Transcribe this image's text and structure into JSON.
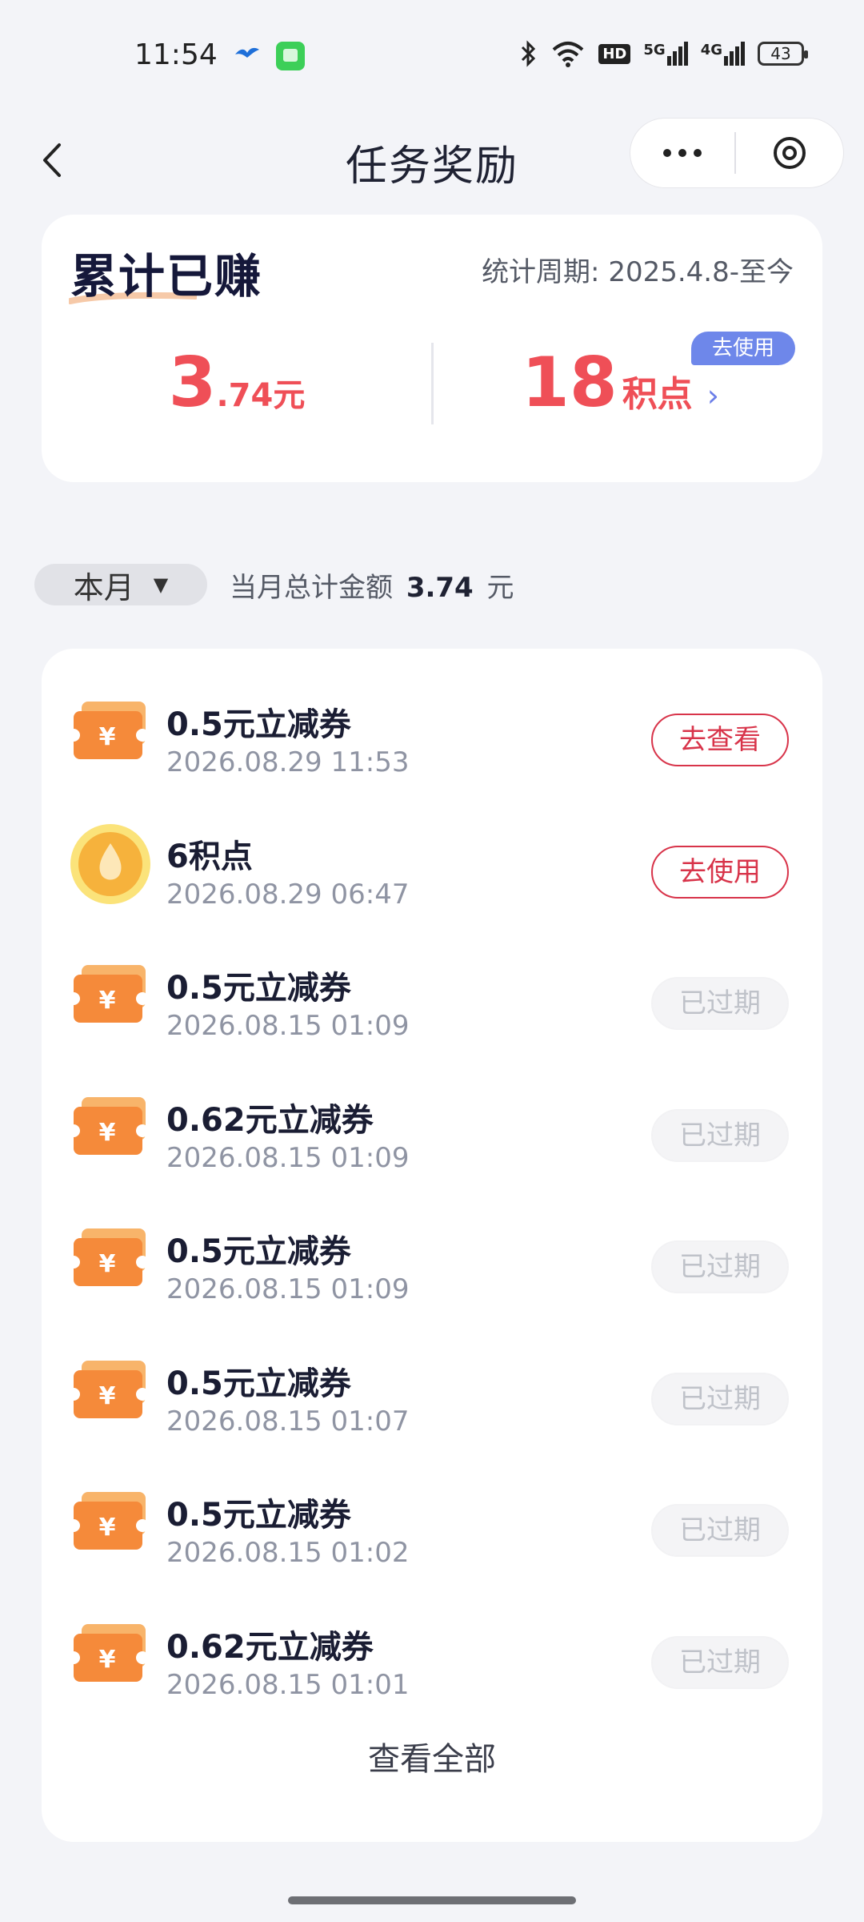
{
  "status_bar": {
    "time": "11:54",
    "hd_label": "HD",
    "net1": "5G",
    "net2": "4G",
    "battery": "43"
  },
  "header": {
    "title": "任务奖励",
    "icons": [
      "back-icon",
      "more-icon",
      "close-icon"
    ]
  },
  "summary": {
    "title": "累计已赚",
    "period": "统计周期: 2025.4.8-至今",
    "money_int": "3",
    "money_dec": ".74元",
    "points_num": "18",
    "points_unit": "积点",
    "use_badge": "去使用",
    "accent_color": "#ef4f57"
  },
  "filter": {
    "month": "本月",
    "total_prefix": "当月总计金额",
    "total_value": "3.74",
    "total_unit": "元"
  },
  "items": [
    {
      "title": "0.5元立减券",
      "time": "2026.08.29 11:53",
      "button": "去查看",
      "state": "active",
      "icon": "coupon"
    },
    {
      "title": "6积点",
      "time": "2026.08.29 06:47",
      "button": "去使用",
      "state": "active",
      "icon": "points"
    },
    {
      "title": "0.5元立减券",
      "time": "2026.08.15 01:09",
      "button": "已过期",
      "state": "expired",
      "icon": "coupon"
    },
    {
      "title": "0.62元立减券",
      "time": "2026.08.15 01:09",
      "button": "已过期",
      "state": "expired",
      "icon": "coupon"
    },
    {
      "title": "0.5元立减券",
      "time": "2026.08.15 01:09",
      "button": "已过期",
      "state": "expired",
      "icon": "coupon"
    },
    {
      "title": "0.5元立减券",
      "time": "2026.08.15 01:07",
      "button": "已过期",
      "state": "expired",
      "icon": "coupon"
    },
    {
      "title": "0.5元立减券",
      "time": "2026.08.15 01:02",
      "button": "已过期",
      "state": "expired",
      "icon": "coupon"
    },
    {
      "title": "0.62元立减券",
      "time": "2026.08.15 01:01",
      "button": "已过期",
      "state": "expired",
      "icon": "coupon"
    }
  ],
  "view_all": "查看全部"
}
